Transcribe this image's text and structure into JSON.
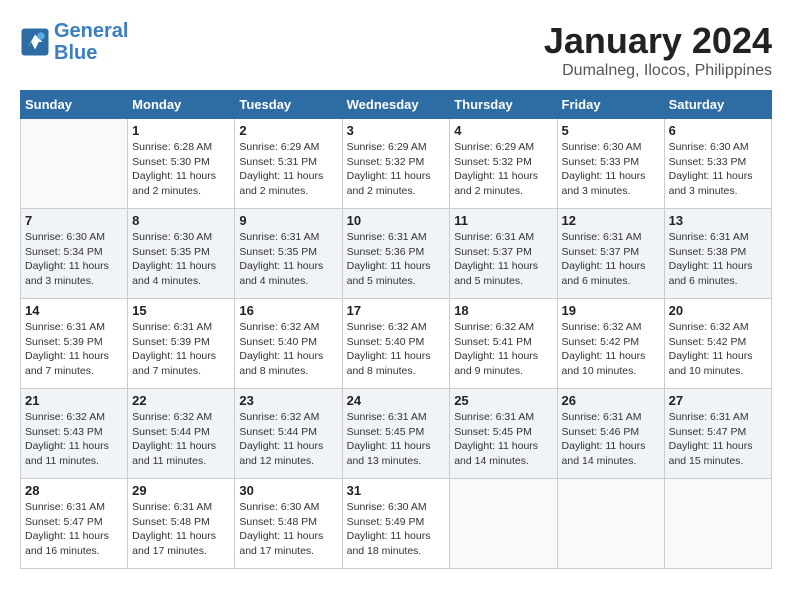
{
  "logo": {
    "line1": "General",
    "line2": "Blue"
  },
  "title": "January 2024",
  "subtitle": "Dumalneg, Ilocos, Philippines",
  "weekdays": [
    "Sunday",
    "Monday",
    "Tuesday",
    "Wednesday",
    "Thursday",
    "Friday",
    "Saturday"
  ],
  "weeks": [
    [
      {
        "day": "",
        "info": ""
      },
      {
        "day": "1",
        "info": "Sunrise: 6:28 AM\nSunset: 5:30 PM\nDaylight: 11 hours\nand 2 minutes."
      },
      {
        "day": "2",
        "info": "Sunrise: 6:29 AM\nSunset: 5:31 PM\nDaylight: 11 hours\nand 2 minutes."
      },
      {
        "day": "3",
        "info": "Sunrise: 6:29 AM\nSunset: 5:32 PM\nDaylight: 11 hours\nand 2 minutes."
      },
      {
        "day": "4",
        "info": "Sunrise: 6:29 AM\nSunset: 5:32 PM\nDaylight: 11 hours\nand 2 minutes."
      },
      {
        "day": "5",
        "info": "Sunrise: 6:30 AM\nSunset: 5:33 PM\nDaylight: 11 hours\nand 3 minutes."
      },
      {
        "day": "6",
        "info": "Sunrise: 6:30 AM\nSunset: 5:33 PM\nDaylight: 11 hours\nand 3 minutes."
      }
    ],
    [
      {
        "day": "7",
        "info": "Sunrise: 6:30 AM\nSunset: 5:34 PM\nDaylight: 11 hours\nand 3 minutes."
      },
      {
        "day": "8",
        "info": "Sunrise: 6:30 AM\nSunset: 5:35 PM\nDaylight: 11 hours\nand 4 minutes."
      },
      {
        "day": "9",
        "info": "Sunrise: 6:31 AM\nSunset: 5:35 PM\nDaylight: 11 hours\nand 4 minutes."
      },
      {
        "day": "10",
        "info": "Sunrise: 6:31 AM\nSunset: 5:36 PM\nDaylight: 11 hours\nand 5 minutes."
      },
      {
        "day": "11",
        "info": "Sunrise: 6:31 AM\nSunset: 5:37 PM\nDaylight: 11 hours\nand 5 minutes."
      },
      {
        "day": "12",
        "info": "Sunrise: 6:31 AM\nSunset: 5:37 PM\nDaylight: 11 hours\nand 6 minutes."
      },
      {
        "day": "13",
        "info": "Sunrise: 6:31 AM\nSunset: 5:38 PM\nDaylight: 11 hours\nand 6 minutes."
      }
    ],
    [
      {
        "day": "14",
        "info": "Sunrise: 6:31 AM\nSunset: 5:39 PM\nDaylight: 11 hours\nand 7 minutes."
      },
      {
        "day": "15",
        "info": "Sunrise: 6:31 AM\nSunset: 5:39 PM\nDaylight: 11 hours\nand 7 minutes."
      },
      {
        "day": "16",
        "info": "Sunrise: 6:32 AM\nSunset: 5:40 PM\nDaylight: 11 hours\nand 8 minutes."
      },
      {
        "day": "17",
        "info": "Sunrise: 6:32 AM\nSunset: 5:40 PM\nDaylight: 11 hours\nand 8 minutes."
      },
      {
        "day": "18",
        "info": "Sunrise: 6:32 AM\nSunset: 5:41 PM\nDaylight: 11 hours\nand 9 minutes."
      },
      {
        "day": "19",
        "info": "Sunrise: 6:32 AM\nSunset: 5:42 PM\nDaylight: 11 hours\nand 10 minutes."
      },
      {
        "day": "20",
        "info": "Sunrise: 6:32 AM\nSunset: 5:42 PM\nDaylight: 11 hours\nand 10 minutes."
      }
    ],
    [
      {
        "day": "21",
        "info": "Sunrise: 6:32 AM\nSunset: 5:43 PM\nDaylight: 11 hours\nand 11 minutes."
      },
      {
        "day": "22",
        "info": "Sunrise: 6:32 AM\nSunset: 5:44 PM\nDaylight: 11 hours\nand 11 minutes."
      },
      {
        "day": "23",
        "info": "Sunrise: 6:32 AM\nSunset: 5:44 PM\nDaylight: 11 hours\nand 12 minutes."
      },
      {
        "day": "24",
        "info": "Sunrise: 6:31 AM\nSunset: 5:45 PM\nDaylight: 11 hours\nand 13 minutes."
      },
      {
        "day": "25",
        "info": "Sunrise: 6:31 AM\nSunset: 5:45 PM\nDaylight: 11 hours\nand 14 minutes."
      },
      {
        "day": "26",
        "info": "Sunrise: 6:31 AM\nSunset: 5:46 PM\nDaylight: 11 hours\nand 14 minutes."
      },
      {
        "day": "27",
        "info": "Sunrise: 6:31 AM\nSunset: 5:47 PM\nDaylight: 11 hours\nand 15 minutes."
      }
    ],
    [
      {
        "day": "28",
        "info": "Sunrise: 6:31 AM\nSunset: 5:47 PM\nDaylight: 11 hours\nand 16 minutes."
      },
      {
        "day": "29",
        "info": "Sunrise: 6:31 AM\nSunset: 5:48 PM\nDaylight: 11 hours\nand 17 minutes."
      },
      {
        "day": "30",
        "info": "Sunrise: 6:30 AM\nSunset: 5:48 PM\nDaylight: 11 hours\nand 17 minutes."
      },
      {
        "day": "31",
        "info": "Sunrise: 6:30 AM\nSunset: 5:49 PM\nDaylight: 11 hours\nand 18 minutes."
      },
      {
        "day": "",
        "info": ""
      },
      {
        "day": "",
        "info": ""
      },
      {
        "day": "",
        "info": ""
      }
    ]
  ]
}
